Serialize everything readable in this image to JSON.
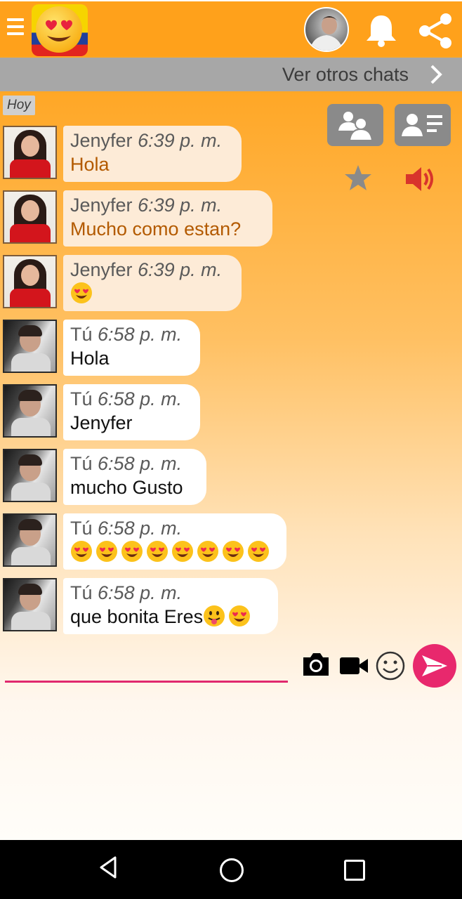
{
  "header": {
    "chats_label": "Ver otros chats",
    "day_label": "Hoy"
  },
  "colors": {
    "header_bg": "#ffa11b",
    "accent_pink": "#e8286d",
    "incoming_bubble": "#fdebd7",
    "outgoing_bubble": "#ffffff",
    "incoming_text": "#b35a00"
  },
  "messages": [
    {
      "sender": "Jenyfer",
      "time": "6:39 p. m.",
      "text": "Hola",
      "emoji": [],
      "direction": "in"
    },
    {
      "sender": "Jenyfer",
      "time": "6:39 p. m.",
      "text": "Mucho como estan?",
      "emoji": [],
      "direction": "in"
    },
    {
      "sender": "Jenyfer",
      "time": "6:39 p. m.",
      "text": "",
      "emoji": [
        "heart-eyes"
      ],
      "direction": "in"
    },
    {
      "sender": "Tú",
      "time": "6:58 p. m.",
      "text": "Hola",
      "emoji": [],
      "direction": "out"
    },
    {
      "sender": "Tú",
      "time": "6:58 p. m.",
      "text": "Jenyfer",
      "emoji": [],
      "direction": "out"
    },
    {
      "sender": "Tú",
      "time": "6:58 p. m.",
      "text": "mucho Gusto",
      "emoji": [],
      "direction": "out"
    },
    {
      "sender": "Tú",
      "time": "6:58 p. m.",
      "text": "",
      "emoji": [
        "heart-eyes",
        "heart-eyes",
        "heart-eyes",
        "heart-eyes",
        "heart-eyes",
        "heart-eyes",
        "heart-eyes",
        "heart-eyes"
      ],
      "direction": "out"
    },
    {
      "sender": "Tú",
      "time": "6:58 p. m.",
      "text": "que bonita Eres",
      "emoji": [
        "tongue-out",
        "heart-eyes"
      ],
      "direction": "out"
    }
  ],
  "composer": {
    "value": "",
    "placeholder": ""
  },
  "icons": {
    "menu": "menu-icon",
    "bell": "bell-icon",
    "share": "share-icon",
    "chevron": "chevron-right-icon",
    "group": "group-users-icon",
    "profile": "profile-card-icon",
    "star": "star-icon",
    "volume": "speaker-icon",
    "camera": "camera-icon",
    "video": "video-camera-icon",
    "emoji": "smiley-icon",
    "send": "send-icon"
  }
}
